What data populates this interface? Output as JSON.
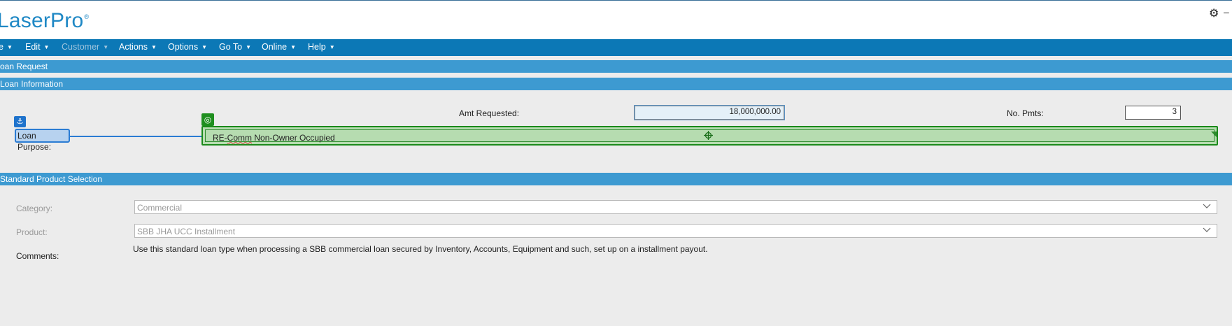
{
  "app": {
    "logo_text": "LaserPro",
    "logo_mark": "®",
    "logo_visible": "aserPro"
  },
  "header": {
    "settings_icon": "gear-icon",
    "dash": "–"
  },
  "menu": [
    {
      "label": "e",
      "disabled": false
    },
    {
      "label": "Edit",
      "disabled": false
    },
    {
      "label": "Customer",
      "disabled": true
    },
    {
      "label": "Actions",
      "disabled": false
    },
    {
      "label": "Options",
      "disabled": false
    },
    {
      "label": "Go To",
      "disabled": false
    },
    {
      "label": "Online",
      "disabled": false
    },
    {
      "label": "Help",
      "disabled": false
    }
  ],
  "sections": {
    "loan_request": "oan Request",
    "loan_information": "Loan Information",
    "standard_product": "Standard Product Selection"
  },
  "loan_info": {
    "amt_requested_label": "Amt Requested:",
    "amt_requested_value": "18,000,000.00",
    "no_pmts_label": "No. Pmts:",
    "no_pmts_value": "3",
    "loan_purpose_label": "Loan Purpose:",
    "loan_purpose_prefix": "RE-",
    "loan_purpose_flagged": "Comm",
    "loan_purpose_rest": " Non-Owner Occupied"
  },
  "product": {
    "category_label": "Category:",
    "category_value": "Commercial",
    "product_label": "Product:",
    "product_value": "SBB JHA UCC Installment",
    "comments_label": "Comments:",
    "comments_value": "Use this standard loan type when processing a SBB commercial loan secured by Inventory, Accounts, Equipment and such, set up on a installment payout."
  },
  "colors": {
    "menubar": "#0c78b6",
    "section_bar": "#3d9ad1",
    "highlight_green": "#b6dcb0",
    "highlight_blue": "#b7d2ef"
  }
}
